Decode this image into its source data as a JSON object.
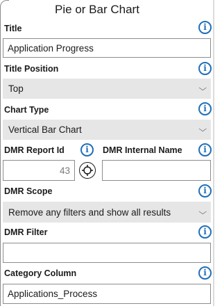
{
  "header": {
    "title": "Pie or Bar Chart"
  },
  "icons": {
    "info": "info-icon",
    "target": "crosshair-icon",
    "chevron": "chevron-down-icon"
  },
  "fields": {
    "title": {
      "label": "Title",
      "value": "Application Progress"
    },
    "title_position": {
      "label": "Title Position",
      "value": "Top"
    },
    "chart_type": {
      "label": "Chart Type",
      "value": "Vertical Bar Chart"
    },
    "dmr_report_id": {
      "label": "DMR Report Id",
      "value": "43"
    },
    "dmr_internal_name": {
      "label": "DMR Internal Name",
      "value": ""
    },
    "dmr_scope": {
      "label": "DMR Scope",
      "value": "Remove any filters and show all results"
    },
    "dmr_filter": {
      "label": "DMR Filter",
      "value": ""
    },
    "category_column": {
      "label": "Category Column",
      "value": "Applications_Process"
    }
  },
  "colors": {
    "info_icon": "#1e6fb8",
    "select_bg": "#e6e6e6",
    "input_border": "#8c8c8c"
  }
}
